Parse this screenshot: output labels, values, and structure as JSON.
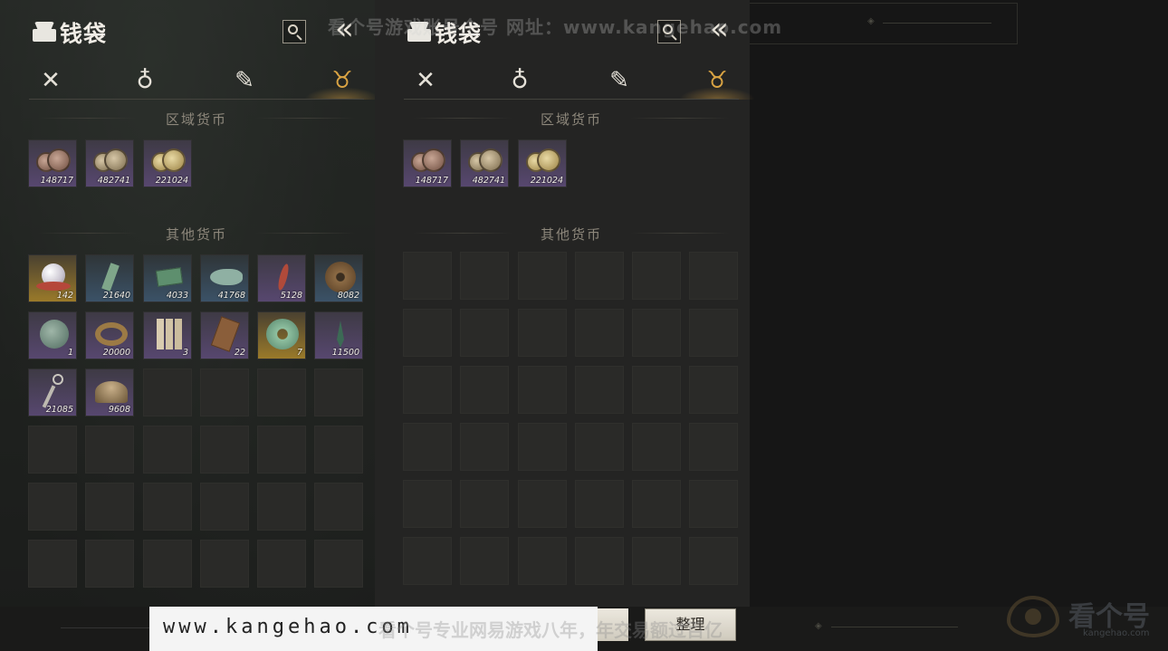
{
  "panel": {
    "title": "钱袋",
    "collapse_glyph": "«",
    "tabs": [
      {
        "icon": "crossed-swords-icon",
        "glyph": "✕",
        "active": false
      },
      {
        "icon": "pouch-icon",
        "glyph": "♁",
        "active": false
      },
      {
        "icon": "scroll-icon",
        "glyph": "✎",
        "active": false
      },
      {
        "icon": "coin-purse-icon",
        "glyph": "♉",
        "active": true
      }
    ],
    "regional_title": "区域货币",
    "other_title": "其他货币"
  },
  "regional_currency": [
    {
      "count": "148717",
      "coin": "c1"
    },
    {
      "count": "482741",
      "coin": "c2"
    },
    {
      "count": "221024",
      "coin": "c3"
    }
  ],
  "other_currency": [
    {
      "count": "142",
      "rarity": "r-gold",
      "art": "pearl"
    },
    {
      "count": "21640",
      "rarity": "r-blue",
      "art": "jade-token"
    },
    {
      "count": "4033",
      "rarity": "r-blue",
      "art": "green-note"
    },
    {
      "count": "41768",
      "rarity": "r-blue",
      "art": "jade-fish"
    },
    {
      "count": "5128",
      "rarity": "r-purple",
      "art": "red-feather"
    },
    {
      "count": "8082",
      "rarity": "r-blue",
      "art": "bronze-coin"
    },
    {
      "count": "1",
      "rarity": "r-purple",
      "art": "jade-disc"
    },
    {
      "count": "20000",
      "rarity": "r-purple",
      "art": "coin-string"
    },
    {
      "count": "3",
      "rarity": "r-purple",
      "art": "bamboo-slips"
    },
    {
      "count": "22",
      "rarity": "r-purple",
      "art": "bronze-plaque"
    },
    {
      "count": "7",
      "rarity": "r-gold",
      "art": "jade-ring"
    },
    {
      "count": "11500",
      "rarity": "r-purple",
      "art": "green-pendant"
    },
    {
      "count": "21085",
      "rarity": "r-purple",
      "art": "silver-pendant"
    },
    {
      "count": "9608",
      "rarity": "r-purple",
      "art": "bronze-bowl"
    }
  ],
  "bottom": {
    "site": "www.kangehao.com",
    "sort_label": "整理"
  },
  "watermarks": {
    "top": "看个号游戏账号个号  网址：www.kangehao.com",
    "bottom": "看个号专业网易游戏八年，年交易额过百亿",
    "logo_name": "看个号",
    "logo_domain": "kangehao.com"
  },
  "colors": {
    "accent_gold": "#d9a343",
    "rarity_purple": "#57476f",
    "rarity_blue": "#3b5267",
    "rarity_gold": "#9a7a2a"
  }
}
